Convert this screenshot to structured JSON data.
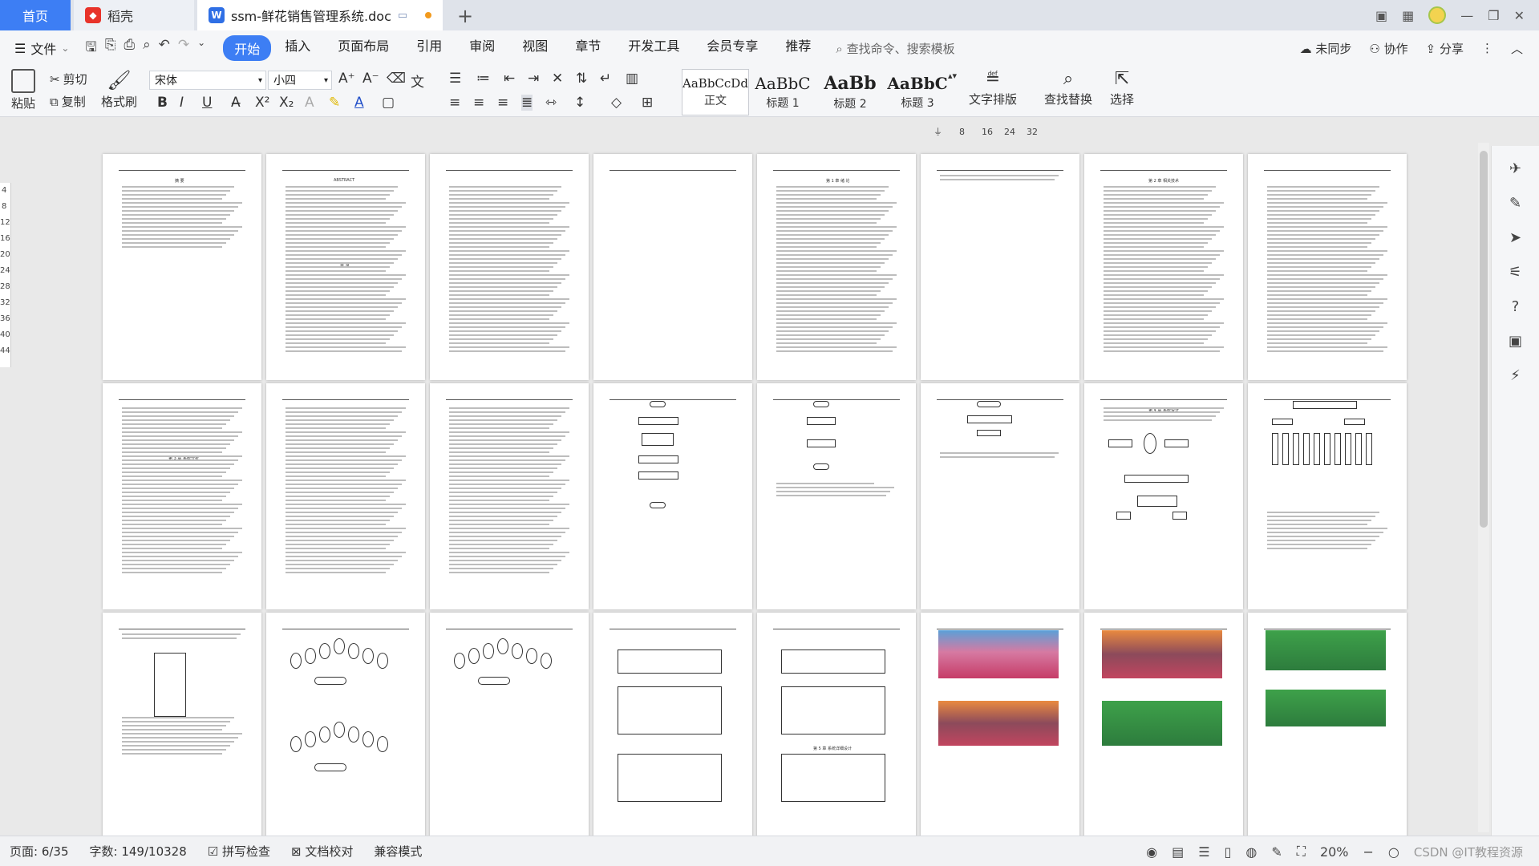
{
  "titlebar": {
    "home_tab": "首页",
    "daoke_tab": "稻壳",
    "doc_tab": "ssm-鲜花销售管理系统.doc",
    "new_tab": "+"
  },
  "menu": {
    "file": "文件",
    "tabs": [
      "开始",
      "插入",
      "页面布局",
      "引用",
      "审阅",
      "视图",
      "章节",
      "开发工具",
      "会员专享",
      "推荐"
    ],
    "search_placeholder": "查找命令、搜索模板",
    "sync": "未同步",
    "collab": "协作",
    "share": "分享"
  },
  "ribbon": {
    "paste": "粘贴",
    "cut": "剪切",
    "copy": "复制",
    "format_painter": "格式刷",
    "font_name": "宋体",
    "font_size": "小四",
    "bold": "B",
    "italic": "I",
    "underline": "U",
    "styles": [
      {
        "sample": "AaBbCcDd",
        "label": "正文"
      },
      {
        "sample": "AaBbC",
        "label": "标题 1"
      },
      {
        "sample": "AaBb",
        "label": "标题 2"
      },
      {
        "sample": "AaBbC",
        "label": "标题 3"
      }
    ],
    "text_layout": "文字排版",
    "find_replace": "查找替换",
    "select": "选择"
  },
  "ruler": {
    "h_marks": [
      "8",
      "16",
      "24",
      "32"
    ],
    "v_marks": [
      "4",
      "8",
      "12",
      "16",
      "20",
      "24",
      "28",
      "32",
      "36",
      "40",
      "44"
    ]
  },
  "pages": {
    "abstract_title": "摘  要",
    "abstract_en_title": "ABSTRACT",
    "toc_title": "目  录",
    "ch1_title": "第 1 章  绪  论",
    "ch2_title": "第 2 章  相关技术",
    "ch3_title": "第 3 章  系统分析",
    "ch4_title": "第 4 章  系统设计",
    "ch5_title": "第 5 章  系统详细设计"
  },
  "status": {
    "page": "页面: 6/35",
    "words": "字数: 149/10328",
    "spell": "拼写检查",
    "proof": "文档校对",
    "compat": "兼容模式",
    "zoom": "20%",
    "watermark": "CSDN @IT教程资源"
  }
}
